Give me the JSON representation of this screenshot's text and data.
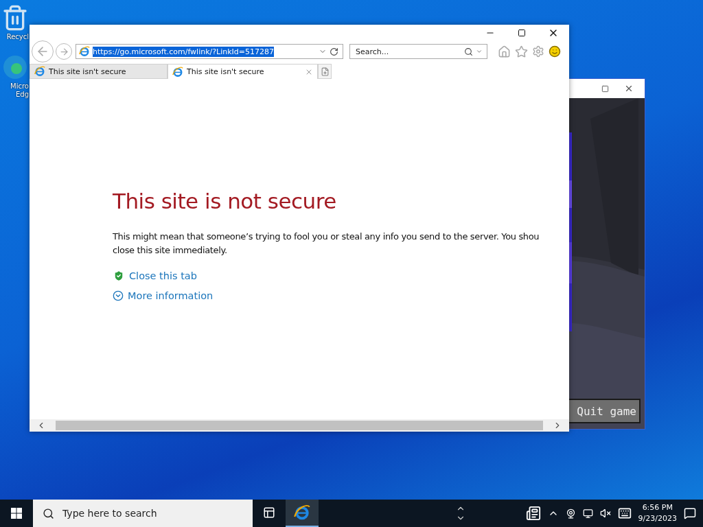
{
  "desktop_icons": [
    {
      "kind": "recycle",
      "label": "Recycl"
    },
    {
      "kind": "edge",
      "label": "Micro\nEdg"
    }
  ],
  "game_window": {
    "button": "Quit game"
  },
  "browser": {
    "address": {
      "value": "https://go.microsoft.com/fwlink/?LinkId=517287",
      "selected": true
    },
    "search": {
      "placeholder": "Search..."
    },
    "tabs": [
      {
        "label": "This site isn't secure",
        "selected": false
      },
      {
        "label": "This site isn't secure",
        "selected": true
      }
    ],
    "page": {
      "title": "This site is not secure",
      "body": "This might mean that someone’s trying to fool you or steal any info you send to the server. You shou\nclose this site immediately.",
      "links": [
        {
          "kind": "shield",
          "label": "Close this tab"
        },
        {
          "kind": "expand",
          "label": "More information"
        }
      ]
    }
  },
  "taskbar": {
    "search": {
      "placeholder": "Type here to search"
    },
    "apps": [
      {
        "kind": "taskview",
        "active": false
      },
      {
        "kind": "ie",
        "active": true
      }
    ],
    "time": "6:56 PM",
    "date": "9/23/2023"
  }
}
